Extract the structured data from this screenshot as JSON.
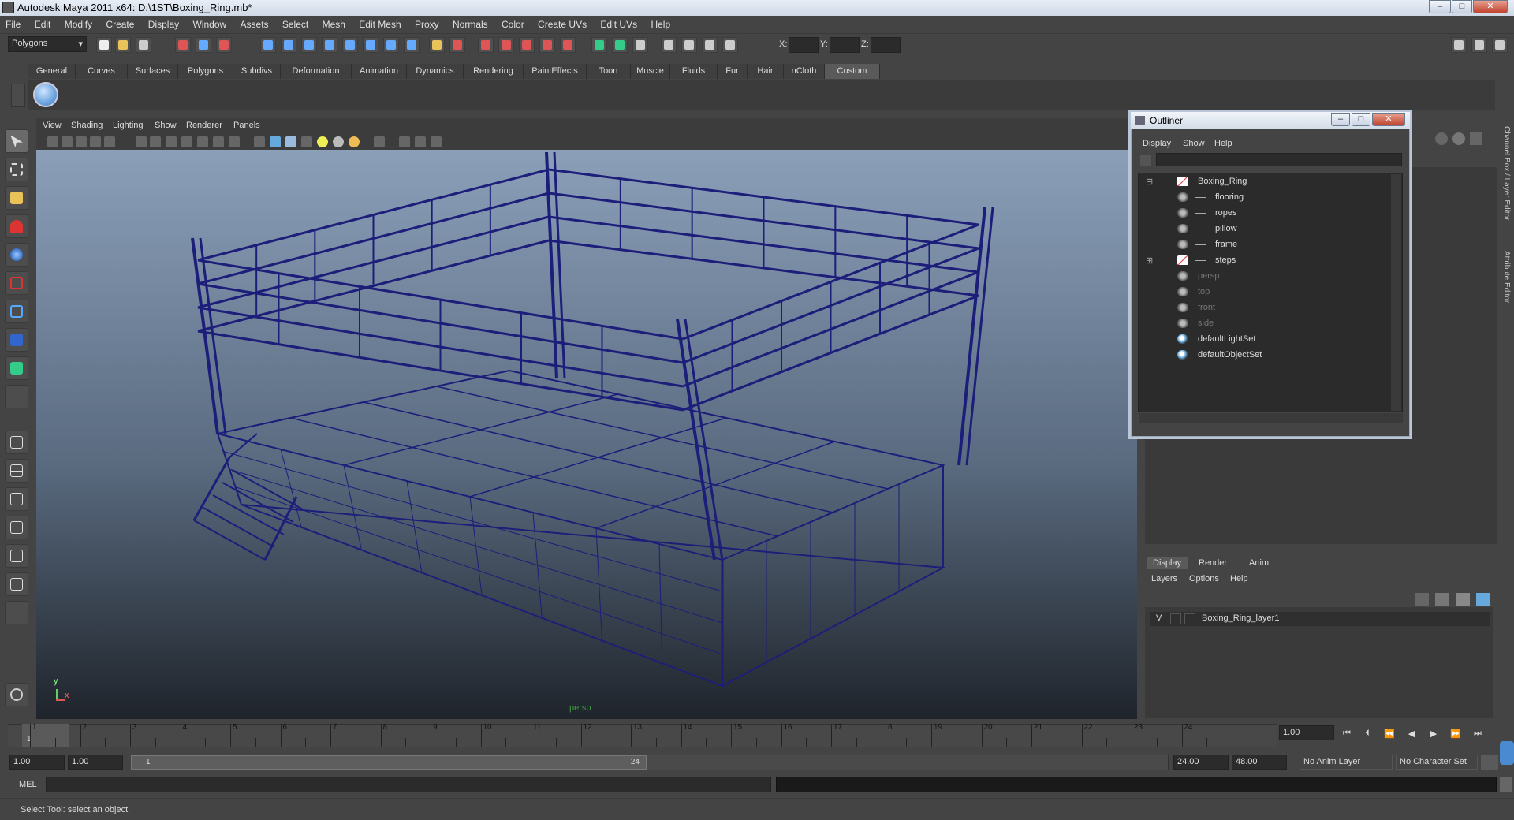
{
  "window": {
    "title": "Autodesk Maya 2011 x64: D:\\1ST\\Boxing_Ring.mb*",
    "minimize": "–",
    "maximize": "□",
    "close": "✕"
  },
  "menubar": [
    "File",
    "Edit",
    "Modify",
    "Create",
    "Display",
    "Window",
    "Assets",
    "Select",
    "Mesh",
    "Edit Mesh",
    "Proxy",
    "Normals",
    "Color",
    "Create UVs",
    "Edit UVs",
    "Help"
  ],
  "statusline": {
    "mode": "Polygons",
    "x_label": "X:",
    "y_label": "Y:",
    "z_label": "Z:"
  },
  "shelf": {
    "tabs": [
      "General",
      "Curves",
      "Surfaces",
      "Polygons",
      "Subdivs",
      "Deformation",
      "Animation",
      "Dynamics",
      "Rendering",
      "PaintEffects",
      "Toon",
      "Muscle",
      "Fluids",
      "Fur",
      "Hair",
      "nCloth",
      "Custom"
    ],
    "active_tab": "Custom"
  },
  "viewport": {
    "menu": [
      "View",
      "Shading",
      "Lighting",
      "Show",
      "Renderer",
      "Panels"
    ],
    "camera_label": "persp",
    "axis_y": "y",
    "axis_x": "x",
    "wire_color": "#1d1d7a"
  },
  "outliner": {
    "title": "Outliner",
    "menu": [
      "Display",
      "Show",
      "Help"
    ],
    "items": [
      {
        "label": "Boxing_Ring",
        "type": "transform",
        "expanded": true,
        "depth": 0,
        "dim": false
      },
      {
        "label": "flooring",
        "type": "mesh",
        "depth": 1,
        "dim": false
      },
      {
        "label": "ropes",
        "type": "mesh",
        "depth": 1,
        "dim": false
      },
      {
        "label": "pillow",
        "type": "mesh",
        "depth": 1,
        "dim": false
      },
      {
        "label": "frame",
        "type": "mesh",
        "depth": 1,
        "dim": false
      },
      {
        "label": "steps",
        "type": "transform",
        "depth": 1,
        "dim": false
      },
      {
        "label": "persp",
        "type": "camera",
        "depth": 0,
        "dim": true
      },
      {
        "label": "top",
        "type": "camera",
        "depth": 0,
        "dim": true
      },
      {
        "label": "front",
        "type": "camera",
        "depth": 0,
        "dim": true
      },
      {
        "label": "side",
        "type": "camera",
        "depth": 0,
        "dim": true
      },
      {
        "label": "defaultLightSet",
        "type": "set",
        "depth": 0,
        "dim": false
      },
      {
        "label": "defaultObjectSet",
        "type": "set",
        "depth": 0,
        "dim": false
      }
    ]
  },
  "side_tabs": [
    "Channel Box / Layer Editor",
    "Attribute Editor"
  ],
  "layer_editor": {
    "tabs": [
      "Display",
      "Render",
      "Anim"
    ],
    "active_tab": "Display",
    "menu": [
      "Layers",
      "Options",
      "Help"
    ],
    "layer_visible": "V",
    "layer_name": "Boxing_Ring_layer1"
  },
  "timeline": {
    "ticks": [
      "1",
      "2",
      "3",
      "4",
      "5",
      "6",
      "7",
      "8",
      "9",
      "10",
      "11",
      "12",
      "13",
      "14",
      "15",
      "16",
      "17",
      "18",
      "19",
      "20",
      "21",
      "22",
      "23",
      "24"
    ],
    "current_frame": "1",
    "current_time_field": "1.00"
  },
  "range": {
    "start_field": "1.00",
    "start_field2": "1.00",
    "slider_start": "1",
    "slider_end": "24",
    "end_field": "24.00",
    "end_field2": "48.00",
    "anim_layer": "No Anim Layer",
    "character_set": "No Character Set"
  },
  "commandline": {
    "label": "MEL"
  },
  "helpline": {
    "text": "Select Tool: select an object"
  }
}
